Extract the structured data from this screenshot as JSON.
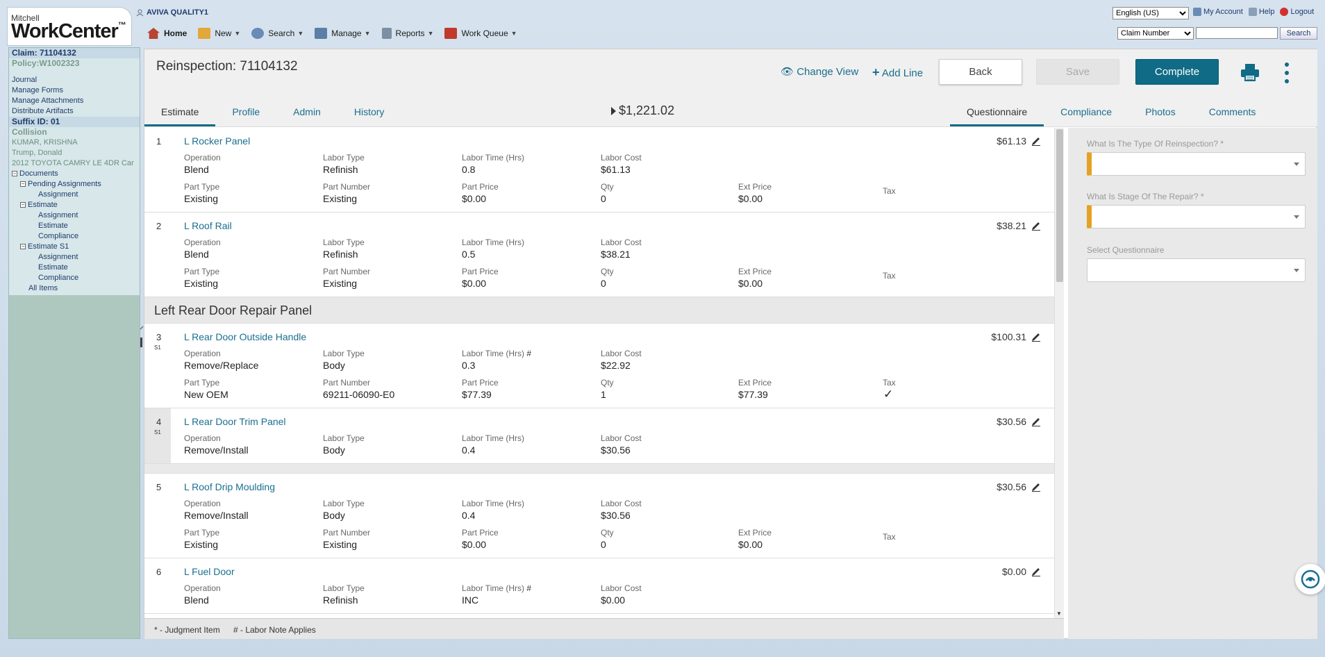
{
  "brand": {
    "small": "Mitchell",
    "big": "WorkCenter",
    "tm": "™"
  },
  "company": "AVIVA QUALITY1",
  "nav": [
    {
      "label": "Home",
      "icon": "home-icon",
      "color": "#b8452f"
    },
    {
      "label": "New",
      "icon": "new-icon",
      "color": "#e2a83a"
    },
    {
      "label": "Search",
      "icon": "search-icon",
      "color": "#6a8bb5"
    },
    {
      "label": "Manage",
      "icon": "manage-icon",
      "color": "#5b7fa6"
    },
    {
      "label": "Reports",
      "icon": "reports-icon",
      "color": "#7c8fa3"
    },
    {
      "label": "Work Queue",
      "icon": "work-queue-icon",
      "color": "#c0392b"
    }
  ],
  "language": "English (US)",
  "toplinks": {
    "account": "My Account",
    "help": "Help",
    "logout": "Logout"
  },
  "search": {
    "type": "Claim Number",
    "button": "Search",
    "value": ""
  },
  "sidebar": {
    "claim": "Claim: 71104132",
    "policy": "Policy:W1002323",
    "links": [
      "Journal",
      "Manage Forms",
      "Manage Attachments",
      "Distribute Artifacts"
    ],
    "suffix": "Suffix ID: 01",
    "collision": "Collision",
    "info": [
      "KUMAR, KRISHNA",
      "Trump, Donald",
      "2012 TOYOTA CAMRY LE 4DR Car"
    ],
    "tree": {
      "documents": "Documents",
      "pending": "Pending Assignments",
      "pending_items": [
        "Assignment"
      ],
      "estimate": "Estimate",
      "estimate_items": [
        "Assignment",
        "Estimate",
        "Compliance"
      ],
      "estimate_s1": "Estimate S1",
      "estimate_s1_items": [
        "Assignment",
        "Estimate",
        "Compliance"
      ],
      "all_items": "All Items"
    }
  },
  "header": {
    "title": "Reinspection: 71104132",
    "change_view": "Change View",
    "add_line": "Add Line",
    "back": "Back",
    "save": "Save",
    "complete": "Complete",
    "total": "$1,221.02"
  },
  "tabs_left": [
    "Estimate",
    "Profile",
    "Admin",
    "History"
  ],
  "tabs_right": [
    "Questionnaire",
    "Compliance",
    "Photos",
    "Comments"
  ],
  "labels": {
    "operation": "Operation",
    "labor_type": "Labor Type",
    "labor_time": "Labor Time (Hrs)",
    "labor_cost": "Labor Cost",
    "part_type": "Part Type",
    "part_number": "Part Number",
    "part_price": "Part Price",
    "qty": "Qty",
    "ext_price": "Ext Price",
    "tax": "Tax",
    "note": "#"
  },
  "lines": [
    {
      "num": "1",
      "name": "L Rocker Panel",
      "price": "$61.13",
      "op": "Blend",
      "lt": "Refinish",
      "time": "0.8",
      "cost": "$61.13",
      "pt": "Existing",
      "pn": "Existing",
      "pp": "$0.00",
      "qty": "0",
      "ext": "$0.00"
    },
    {
      "num": "2",
      "name": "L Roof Rail",
      "price": "$38.21",
      "op": "Blend",
      "lt": "Refinish",
      "time": "0.5",
      "cost": "$38.21",
      "pt": "Existing",
      "pn": "Existing",
      "pp": "$0.00",
      "qty": "0",
      "ext": "$0.00"
    },
    {
      "num": "3",
      "sup": "S1",
      "name": "L Rear Door Outside Handle",
      "price": "$100.31",
      "op": "Remove/Replace",
      "lt": "Body",
      "time": "0.3",
      "cost": "$22.92",
      "pt": "New OEM",
      "pn": "69211-06090-E0",
      "pp": "$77.39",
      "qty": "1",
      "ext": "$77.39",
      "taxed": "✓"
    },
    {
      "num": "4",
      "sup": "S1",
      "name": "L Rear Door Trim Panel",
      "price": "$30.56",
      "op": "Remove/Install",
      "lt": "Body",
      "time": "0.4",
      "cost": "$30.56"
    },
    {
      "num": "5",
      "name": "L Roof Drip Moulding",
      "price": "$30.56",
      "op": "Remove/Install",
      "lt": "Body",
      "time": "0.4",
      "cost": "$30.56",
      "pt": "Existing",
      "pn": "Existing",
      "pp": "$0.00",
      "qty": "0",
      "ext": "$0.00"
    },
    {
      "num": "6",
      "name": "L Fuel Door",
      "price": "$0.00",
      "op": "Blend",
      "lt": "Refinish",
      "time": "INC",
      "cost": "$0.00"
    }
  ],
  "group_header": "Left Rear Door Repair Panel",
  "footer": {
    "judgment": "* - Judgment Item",
    "labor_note": "# - Labor Note Applies"
  },
  "questionnaire": {
    "q1": "What Is The Type Of Reinspection? *",
    "q2": "What Is Stage Of The Repair? *",
    "q3": "Select Questionnaire"
  },
  "colors": {
    "accent": "#0f6b86",
    "link": "#1a6e8e",
    "required": "#e5a122"
  }
}
